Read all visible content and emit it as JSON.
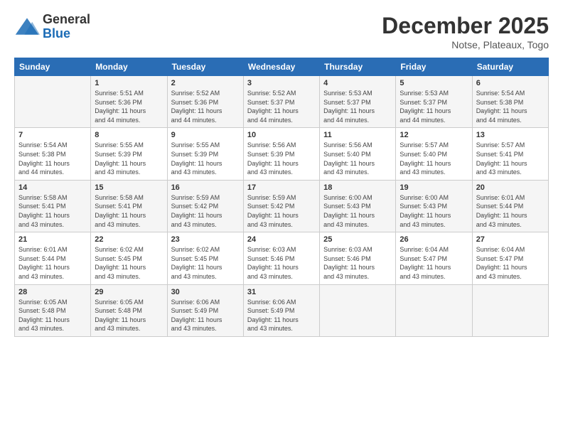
{
  "header": {
    "logo_general": "General",
    "logo_blue": "Blue",
    "month_title": "December 2025",
    "location": "Notse, Plateaux, Togo"
  },
  "days_of_week": [
    "Sunday",
    "Monday",
    "Tuesday",
    "Wednesday",
    "Thursday",
    "Friday",
    "Saturday"
  ],
  "weeks": [
    [
      {
        "day": "",
        "info": ""
      },
      {
        "day": "1",
        "info": "Sunrise: 5:51 AM\nSunset: 5:36 PM\nDaylight: 11 hours\nand 44 minutes."
      },
      {
        "day": "2",
        "info": "Sunrise: 5:52 AM\nSunset: 5:36 PM\nDaylight: 11 hours\nand 44 minutes."
      },
      {
        "day": "3",
        "info": "Sunrise: 5:52 AM\nSunset: 5:37 PM\nDaylight: 11 hours\nand 44 minutes."
      },
      {
        "day": "4",
        "info": "Sunrise: 5:53 AM\nSunset: 5:37 PM\nDaylight: 11 hours\nand 44 minutes."
      },
      {
        "day": "5",
        "info": "Sunrise: 5:53 AM\nSunset: 5:37 PM\nDaylight: 11 hours\nand 44 minutes."
      },
      {
        "day": "6",
        "info": "Sunrise: 5:54 AM\nSunset: 5:38 PM\nDaylight: 11 hours\nand 44 minutes."
      }
    ],
    [
      {
        "day": "7",
        "info": "Sunrise: 5:54 AM\nSunset: 5:38 PM\nDaylight: 11 hours\nand 44 minutes."
      },
      {
        "day": "8",
        "info": "Sunrise: 5:55 AM\nSunset: 5:39 PM\nDaylight: 11 hours\nand 43 minutes."
      },
      {
        "day": "9",
        "info": "Sunrise: 5:55 AM\nSunset: 5:39 PM\nDaylight: 11 hours\nand 43 minutes."
      },
      {
        "day": "10",
        "info": "Sunrise: 5:56 AM\nSunset: 5:39 PM\nDaylight: 11 hours\nand 43 minutes."
      },
      {
        "day": "11",
        "info": "Sunrise: 5:56 AM\nSunset: 5:40 PM\nDaylight: 11 hours\nand 43 minutes."
      },
      {
        "day": "12",
        "info": "Sunrise: 5:57 AM\nSunset: 5:40 PM\nDaylight: 11 hours\nand 43 minutes."
      },
      {
        "day": "13",
        "info": "Sunrise: 5:57 AM\nSunset: 5:41 PM\nDaylight: 11 hours\nand 43 minutes."
      }
    ],
    [
      {
        "day": "14",
        "info": "Sunrise: 5:58 AM\nSunset: 5:41 PM\nDaylight: 11 hours\nand 43 minutes."
      },
      {
        "day": "15",
        "info": "Sunrise: 5:58 AM\nSunset: 5:41 PM\nDaylight: 11 hours\nand 43 minutes."
      },
      {
        "day": "16",
        "info": "Sunrise: 5:59 AM\nSunset: 5:42 PM\nDaylight: 11 hours\nand 43 minutes."
      },
      {
        "day": "17",
        "info": "Sunrise: 5:59 AM\nSunset: 5:42 PM\nDaylight: 11 hours\nand 43 minutes."
      },
      {
        "day": "18",
        "info": "Sunrise: 6:00 AM\nSunset: 5:43 PM\nDaylight: 11 hours\nand 43 minutes."
      },
      {
        "day": "19",
        "info": "Sunrise: 6:00 AM\nSunset: 5:43 PM\nDaylight: 11 hours\nand 43 minutes."
      },
      {
        "day": "20",
        "info": "Sunrise: 6:01 AM\nSunset: 5:44 PM\nDaylight: 11 hours\nand 43 minutes."
      }
    ],
    [
      {
        "day": "21",
        "info": "Sunrise: 6:01 AM\nSunset: 5:44 PM\nDaylight: 11 hours\nand 43 minutes."
      },
      {
        "day": "22",
        "info": "Sunrise: 6:02 AM\nSunset: 5:45 PM\nDaylight: 11 hours\nand 43 minutes."
      },
      {
        "day": "23",
        "info": "Sunrise: 6:02 AM\nSunset: 5:45 PM\nDaylight: 11 hours\nand 43 minutes."
      },
      {
        "day": "24",
        "info": "Sunrise: 6:03 AM\nSunset: 5:46 PM\nDaylight: 11 hours\nand 43 minutes."
      },
      {
        "day": "25",
        "info": "Sunrise: 6:03 AM\nSunset: 5:46 PM\nDaylight: 11 hours\nand 43 minutes."
      },
      {
        "day": "26",
        "info": "Sunrise: 6:04 AM\nSunset: 5:47 PM\nDaylight: 11 hours\nand 43 minutes."
      },
      {
        "day": "27",
        "info": "Sunrise: 6:04 AM\nSunset: 5:47 PM\nDaylight: 11 hours\nand 43 minutes."
      }
    ],
    [
      {
        "day": "28",
        "info": "Sunrise: 6:05 AM\nSunset: 5:48 PM\nDaylight: 11 hours\nand 43 minutes."
      },
      {
        "day": "29",
        "info": "Sunrise: 6:05 AM\nSunset: 5:48 PM\nDaylight: 11 hours\nand 43 minutes."
      },
      {
        "day": "30",
        "info": "Sunrise: 6:06 AM\nSunset: 5:49 PM\nDaylight: 11 hours\nand 43 minutes."
      },
      {
        "day": "31",
        "info": "Sunrise: 6:06 AM\nSunset: 5:49 PM\nDaylight: 11 hours\nand 43 minutes."
      },
      {
        "day": "",
        "info": ""
      },
      {
        "day": "",
        "info": ""
      },
      {
        "day": "",
        "info": ""
      }
    ]
  ]
}
